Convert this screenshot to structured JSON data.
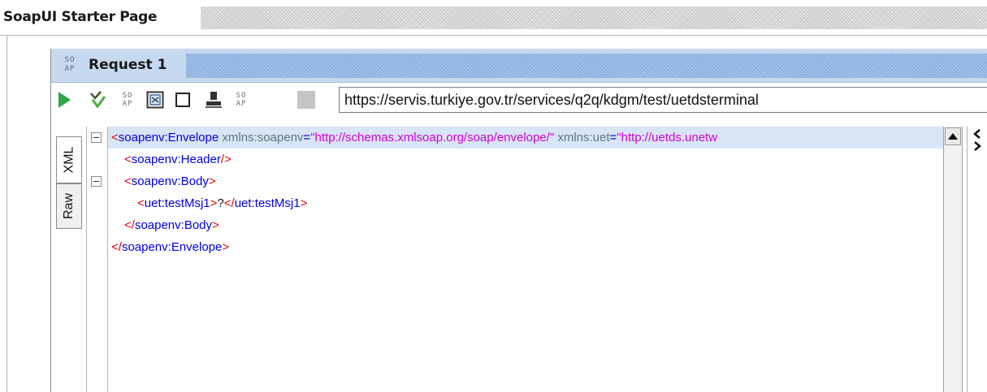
{
  "tab": {
    "title": "SoapUI Starter Page"
  },
  "request": {
    "icon_text_top": "SO",
    "icon_text_bottom": "AP",
    "title": "Request 1"
  },
  "toolbar": {
    "endpoint_url": "https://servis.turkiye.gov.tr/services/q2q/kdgm/test/uetdsterminal",
    "icons": [
      "play-icon",
      "validate-icon",
      "soap-icon",
      "format-icon",
      "checkbox-icon",
      "user-icon",
      "soap-icon",
      "stop-icon"
    ]
  },
  "editor": {
    "tabs": [
      "XML",
      "Raw"
    ],
    "lines": {
      "l1": {
        "open": "<",
        "name": "soapenv:Envelope",
        "attr1": " xmlns:soapenv",
        "eq1": "=",
        "val1": "\"http://schemas.xmlsoap.org/soap/envelope/\"",
        "attr2": " xmlns:uet",
        "eq2": "=",
        "val2": "\"http://uetds.unetw"
      },
      "l2": {
        "open": "<",
        "name": "soapenv:Header",
        "close": "/>"
      },
      "l3": {
        "open": "<",
        "name": "soapenv:Body",
        "close": ">"
      },
      "l4": {
        "open": "<",
        "name": "uet:testMsj1",
        "close": ">",
        "text": "?",
        "open2": "</",
        "name2": "uet:testMsj1",
        "close2": ">"
      },
      "l5": {
        "open": "</",
        "name": "soapenv:Body",
        "close": ">"
      },
      "l6": {
        "open": "</",
        "name": "soapenv:Envelope",
        "close": ">"
      }
    }
  },
  "colors": {
    "tag": "#e8000b",
    "element": "#0000e0",
    "attribute": "#5a7a7a",
    "value": "#d000d0",
    "header_bg": "#c7d9ee",
    "run_green": "#2ea84a"
  }
}
